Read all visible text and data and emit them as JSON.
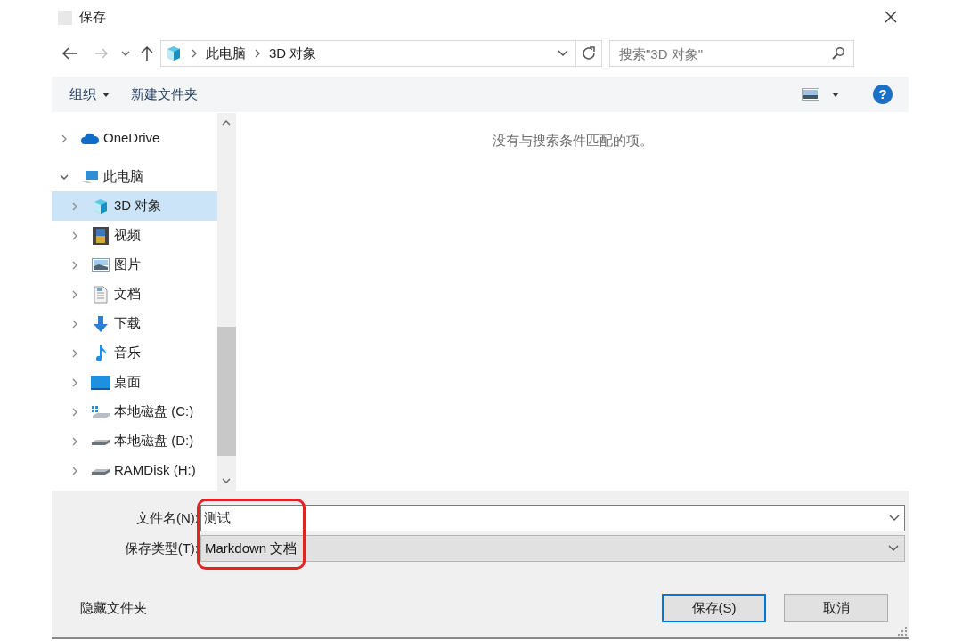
{
  "window": {
    "title": "保存"
  },
  "address": {
    "breadcrumb": [
      "此电脑",
      "3D 对象"
    ]
  },
  "search": {
    "placeholder": "搜索\"3D 对象\""
  },
  "toolbar": {
    "items": [
      {
        "label": "组织",
        "kind": "menu"
      },
      {
        "label": "新建文件夹",
        "kind": "button"
      }
    ],
    "help": "?"
  },
  "tree": [
    {
      "label": "OneDrive",
      "kind": "cloud",
      "expanded": false,
      "selected": false
    },
    {
      "label": "此电脑",
      "kind": "pc",
      "expanded": true,
      "selected": false,
      "children": [
        {
          "label": "3D 对象",
          "kind": "cube",
          "expanded": false,
          "selected": true
        },
        {
          "label": "视频",
          "kind": "video",
          "expanded": false,
          "selected": false
        },
        {
          "label": "图片",
          "kind": "picture",
          "expanded": false,
          "selected": false
        },
        {
          "label": "文档",
          "kind": "document",
          "expanded": false,
          "selected": false
        },
        {
          "label": "下载",
          "kind": "download",
          "expanded": false,
          "selected": false
        },
        {
          "label": "音乐",
          "kind": "music",
          "expanded": false,
          "selected": false
        },
        {
          "label": "桌面",
          "kind": "desktop",
          "expanded": false,
          "selected": false
        },
        {
          "label": "本地磁盘 (C:)",
          "kind": "systemdrive",
          "expanded": false,
          "selected": false
        },
        {
          "label": "本地磁盘 (D:)",
          "kind": "drive",
          "expanded": false,
          "selected": false
        },
        {
          "label": "RAMDisk (H:)",
          "kind": "drive",
          "expanded": false,
          "selected": false
        }
      ]
    }
  ],
  "content": {
    "empty_message": "没有与搜索条件匹配的项。"
  },
  "form": {
    "filename": {
      "label": "文件名(N):",
      "value": "测试"
    },
    "filetype": {
      "label": "保存类型(T):",
      "value": "Markdown 文档"
    }
  },
  "hide_folders": "隐藏文件夹",
  "buttons": [
    {
      "label": "保存(S)",
      "default": true
    },
    {
      "label": "取消",
      "default": false
    }
  ]
}
